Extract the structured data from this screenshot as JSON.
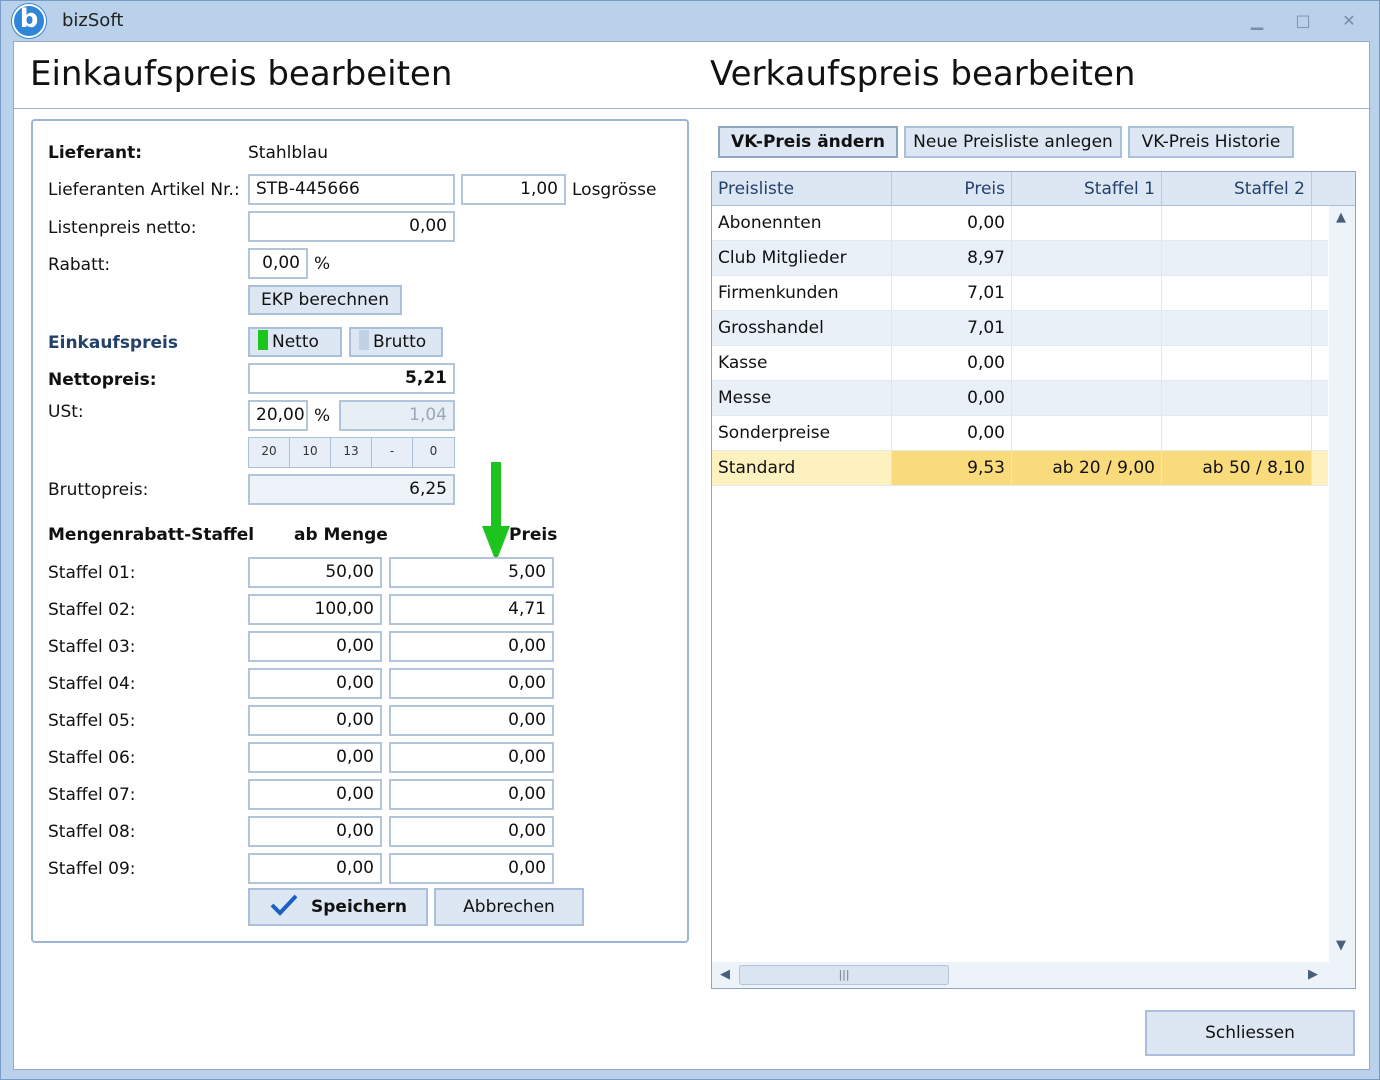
{
  "window": {
    "title": "bizSoft",
    "icon": "bizsoft-logo-icon"
  },
  "left_title": "Einkaufspreis bearbeiten",
  "right_title": "Verkaufspreis bearbeiten",
  "form": {
    "lieferant_label": "Lieferant:",
    "lieferant_value": "Stahlblau",
    "artikel_label": "Lieferanten Artikel Nr.:",
    "artikel_value": "STB-445666",
    "losgroesse_value": "1,00",
    "losgroesse_label": "Losgrösse",
    "listenpreis_label": "Listenpreis netto:",
    "listenpreis_value": "0,00",
    "rabatt_label": "Rabatt:",
    "rabatt_value": "0,00",
    "percent": "%",
    "ekp_button": "EKP berechnen",
    "einkaufspreis_label": "Einkaufspreis",
    "netto_toggle": "Netto",
    "brutto_toggle": "Brutto",
    "netto_color": "#1ec41e",
    "nettopreis_label": "Nettopreis:",
    "nettopreis_value": "5,21",
    "ust_label": "USt:",
    "ust_value": "20,00",
    "ust_amount": "1,04",
    "ust_presets": [
      "20",
      "10",
      "13",
      "-",
      "0"
    ],
    "bruttopreis_label": "Bruttopreis:",
    "bruttopreis_value": "6,25"
  },
  "staffel": {
    "header_label": "Mengenrabatt-Staffel",
    "header_menge": "ab Menge",
    "header_preis": "Preis",
    "rows": [
      {
        "label": "Staffel 01:",
        "menge": "50,00",
        "preis": "5,00"
      },
      {
        "label": "Staffel 02:",
        "menge": "100,00",
        "preis": "4,71"
      },
      {
        "label": "Staffel 03:",
        "menge": "0,00",
        "preis": "0,00"
      },
      {
        "label": "Staffel 04:",
        "menge": "0,00",
        "preis": "0,00"
      },
      {
        "label": "Staffel 05:",
        "menge": "0,00",
        "preis": "0,00"
      },
      {
        "label": "Staffel 06:",
        "menge": "0,00",
        "preis": "0,00"
      },
      {
        "label": "Staffel 07:",
        "menge": "0,00",
        "preis": "0,00"
      },
      {
        "label": "Staffel 08:",
        "menge": "0,00",
        "preis": "0,00"
      },
      {
        "label": "Staffel 09:",
        "menge": "0,00",
        "preis": "0,00"
      }
    ]
  },
  "actions": {
    "save": "Speichern",
    "cancel": "Abbrechen",
    "close": "Schliessen"
  },
  "vk_toolbar": {
    "change": "VK-Preis ändern",
    "new_list": "Neue Preisliste anlegen",
    "history": "VK-Preis Historie"
  },
  "grid": {
    "columns": [
      "Preisliste",
      "Preis",
      "Staffel 1",
      "Staffel 2"
    ],
    "rows": [
      {
        "name": "Abonennten",
        "preis": "0,00",
        "s1": "",
        "s2": ""
      },
      {
        "name": "Club Mitglieder",
        "preis": "8,97",
        "s1": "",
        "s2": ""
      },
      {
        "name": "Firmenkunden",
        "preis": "7,01",
        "s1": "",
        "s2": ""
      },
      {
        "name": "Grosshandel",
        "preis": "7,01",
        "s1": "",
        "s2": ""
      },
      {
        "name": "Kasse",
        "preis": "0,00",
        "s1": "",
        "s2": ""
      },
      {
        "name": "Messe",
        "preis": "0,00",
        "s1": "",
        "s2": ""
      },
      {
        "name": "Sonderpreise",
        "preis": "0,00",
        "s1": "",
        "s2": ""
      },
      {
        "name": "Standard",
        "preis": "9,53",
        "s1": "ab 20 / 9,00",
        "s2": "ab 50 / 8,10"
      }
    ],
    "selected_row": "Standard"
  }
}
